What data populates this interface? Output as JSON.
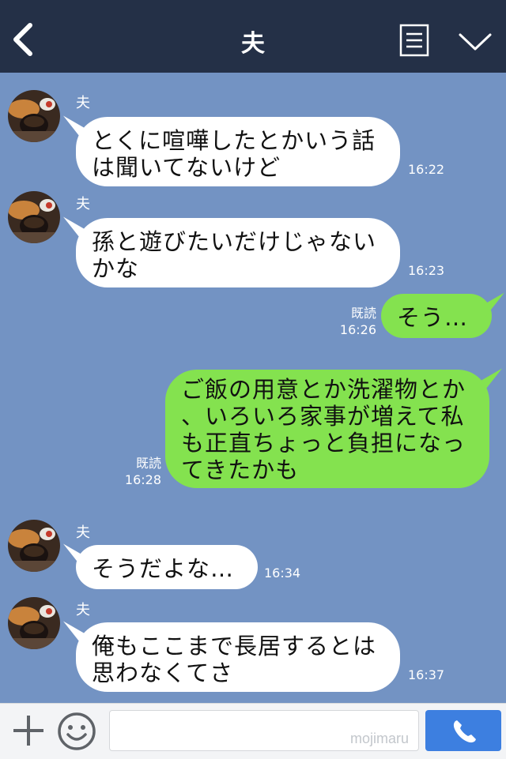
{
  "header": {
    "title": "夫",
    "icons": [
      "back-chevron-icon",
      "menu-list-icon",
      "chevron-down-icon"
    ],
    "background": "#243047"
  },
  "chat_background": "#7393c3",
  "messages": [
    {
      "direction": "in",
      "sender": "夫",
      "text": "とくに喧嘩したとかいう話\nは聞いてないけど",
      "time": "16:22"
    },
    {
      "direction": "in",
      "sender": "夫",
      "text": "孫と遊びたいだけじゃない\nかな",
      "time": "16:23"
    },
    {
      "direction": "out",
      "read": "既読",
      "text": "そう…",
      "time": "16:26"
    },
    {
      "direction": "out",
      "read": "既読",
      "text": "ご飯の用意とか洗濯物とか\n、いろいろ家事が増えて私\nも正直ちょっと負担になっ\nてきたかも",
      "time": "16:28"
    },
    {
      "direction": "in",
      "sender": "夫",
      "text": "そうだよな…",
      "time": "16:34"
    },
    {
      "direction": "in",
      "sender": "夫",
      "text": "俺もここまで長居するとは\n思わなくてさ",
      "time": "16:37"
    }
  ],
  "footer": {
    "input_value": "",
    "watermark": "mojimaru",
    "icons": [
      "plus-icon",
      "smiley-icon",
      "phone-icon"
    ],
    "call_button_color": "#3d7fe0"
  },
  "colors": {
    "outgoing_bubble": "#84e24f",
    "incoming_bubble": "#ffffff"
  }
}
